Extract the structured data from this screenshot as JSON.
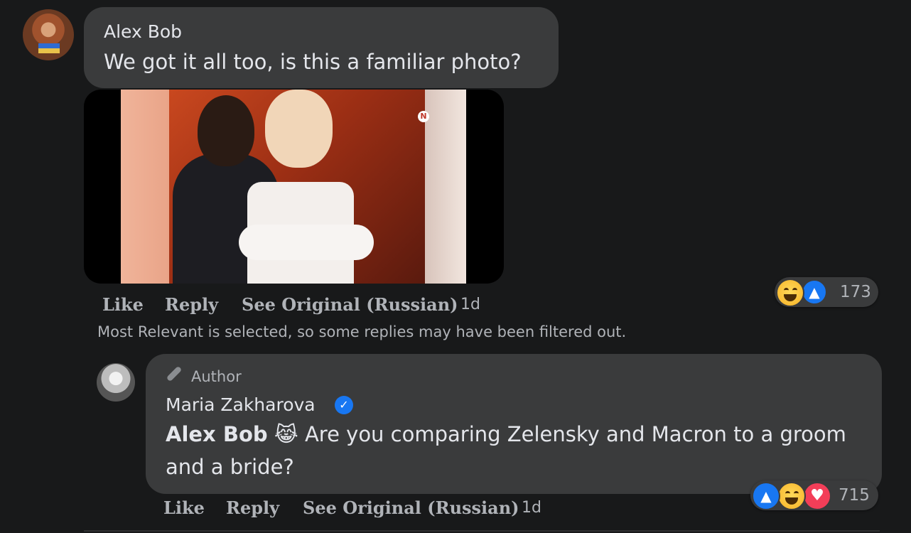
{
  "comment": {
    "author": "Alex Bob",
    "text": "We got it all too, is this a familiar photo?",
    "photo_watermark": "N",
    "actions": {
      "like": "Like",
      "reply": "Reply",
      "see_original": "See Original (Russian)"
    },
    "time": "1d",
    "reactions": {
      "count": "173",
      "icons": [
        "haha-icon",
        "like-icon"
      ]
    }
  },
  "filter_note": "Most Relevant is selected, so some replies may have been filtered out.",
  "reply": {
    "badge": "Author",
    "author": "Maria Zakharova",
    "verified": true,
    "mention": "Alex Bob",
    "emoji": "😹",
    "text": "Are you comparing Zelensky and Macron to a groom and a bride?",
    "actions": {
      "like": "Like",
      "reply": "Reply",
      "see_original": "See Original (Russian)"
    },
    "time": "1d",
    "reactions": {
      "count": "715",
      "icons": [
        "like-icon",
        "haha-icon",
        "love-icon"
      ]
    }
  },
  "colors": {
    "background": "#18191a",
    "bubble": "#3a3b3c",
    "like": "#1877f2",
    "love": "#f33e58",
    "haha": "#f7b125"
  }
}
